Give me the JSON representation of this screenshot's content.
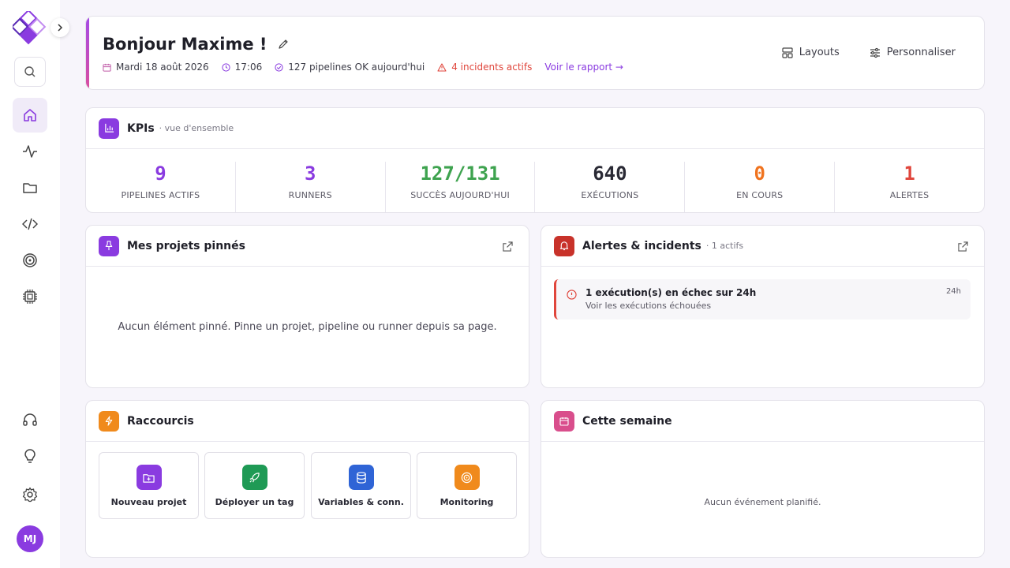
{
  "header": {
    "greeting": "Bonjour Maxime !",
    "date": "Mardi 18 août 2026",
    "time": "17:06",
    "pipelines_status": "127 pipelines OK aujourd'hui",
    "incidents": "4 incidents actifs",
    "report_link": "Voir le rapport →",
    "layouts_label": "Layouts",
    "customize_label": "Personnaliser"
  },
  "sidebar": {
    "avatar_initials": "MJ"
  },
  "kpis": {
    "title": "KPIs",
    "subtitle": "· vue d'ensemble",
    "items": [
      {
        "value": "9",
        "label": "PIPELINES ACTIFS",
        "color": "#8a3be0"
      },
      {
        "value": "3",
        "label": "RUNNERS",
        "color": "#8a3be0"
      },
      {
        "value": "127/131",
        "label": "SUCCÈS AUJOURD'HUI",
        "color": "#3ea34f"
      },
      {
        "value": "640",
        "label": "EXÉCUTIONS",
        "color": "#2a2a35"
      },
      {
        "value": "0",
        "label": "EN COURS",
        "color": "#f0731f"
      },
      {
        "value": "1",
        "label": "ALERTES",
        "color": "#e0463c"
      }
    ]
  },
  "pinned": {
    "title": "Mes projets pinnés",
    "empty": "Aucun élément pinné. Pinne un projet, pipeline ou runner depuis sa page."
  },
  "alerts": {
    "title": "Alertes & incidents",
    "subtitle": "· 1 actifs",
    "items": [
      {
        "title": "1 exécution(s) en échec sur 24h",
        "desc": "Voir les exécutions échouées",
        "time": "24h"
      }
    ]
  },
  "shortcuts": {
    "title": "Raccourcis",
    "items": [
      {
        "label": "Nouveau projet",
        "icon": "folder-plus-icon",
        "color": "#8a3be0"
      },
      {
        "label": "Déployer un tag",
        "icon": "rocket-icon",
        "color": "#1f9a55"
      },
      {
        "label": "Variables & conn.",
        "icon": "database-icon",
        "color": "#2f64d6"
      },
      {
        "label": "Monitoring",
        "icon": "target-icon",
        "color": "#f08a1c"
      }
    ]
  },
  "week": {
    "title": "Cette semaine",
    "empty": "Aucun événement planifié."
  },
  "colors": {
    "accent": "#8a3be0",
    "danger": "#e0463c",
    "success": "#3ea34f"
  }
}
